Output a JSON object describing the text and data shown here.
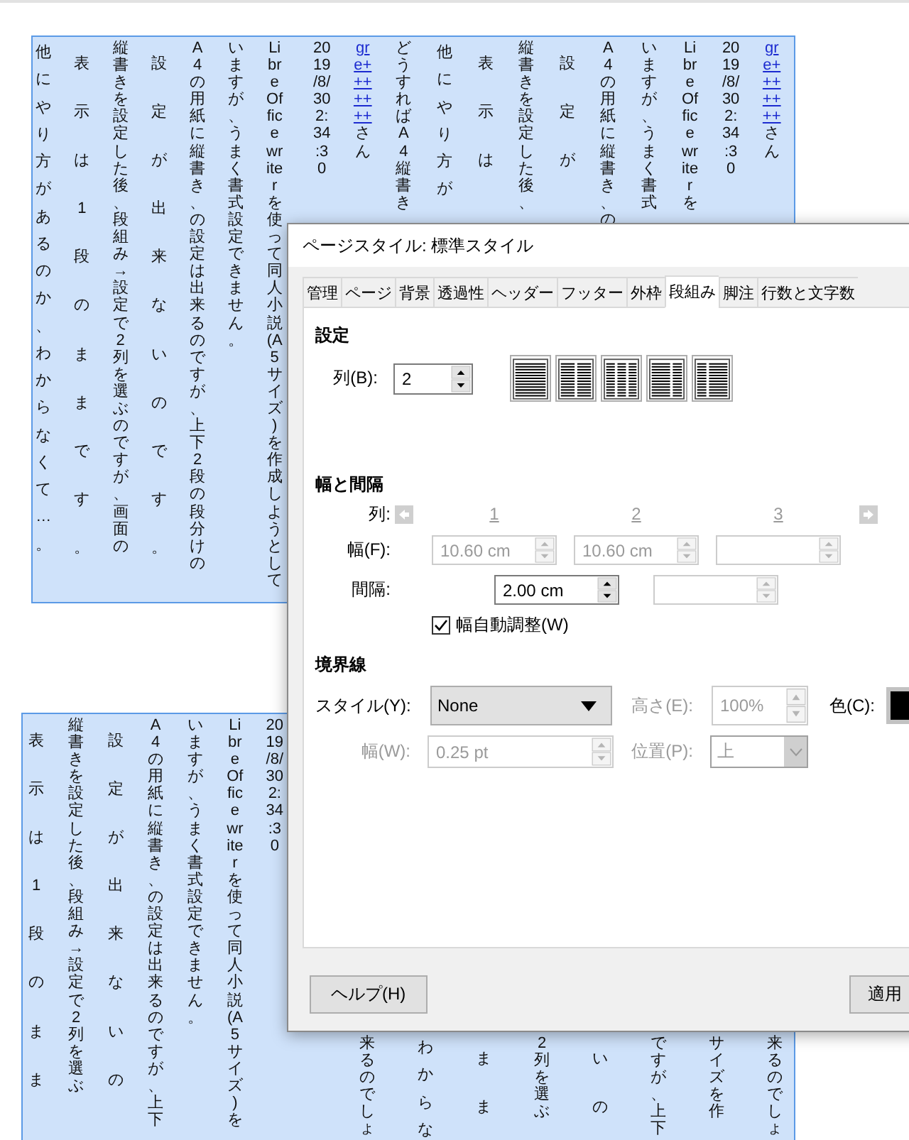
{
  "document": {
    "pages": [
      {
        "left_columns": [
          {
            "kind": "loose",
            "text": "他にやり方があるのか、わからなくて…。"
          },
          {
            "kind": "spaced",
            "text": "表示は1段のままです。"
          },
          {
            "kind": "text",
            "text": "縦書きを設定した後、段組み→設定で2列を選ぶのですが、画面の"
          },
          {
            "kind": "spaced",
            "text": "設定が出来ないのです。"
          },
          {
            "kind": "text",
            "text": "A4の用紙に縦書き、の設定は出来るのですが、上下2段の段分けの"
          },
          {
            "kind": "text",
            "text": "いますが、うまく書式設定できません。"
          },
          {
            "kind": "text",
            "text": "LibreOffice writerを使って同人小説(A5サイズ)を作成しようとして"
          }
        ],
        "right_columns": [
          {
            "kind": "text",
            "text": "2019/8/302:34:30"
          },
          {
            "kind": "user",
            "link": "gre+++++++",
            "suffix": "さん"
          },
          {
            "kind": "text",
            "text": "どうすればA4縦書き"
          },
          {
            "kind": "loose",
            "text": "他にやり方が"
          },
          {
            "kind": "spaced",
            "text": "表示は"
          },
          {
            "kind": "text",
            "text": "縦書きを設定した後、"
          },
          {
            "kind": "spaced",
            "text": "設定が"
          },
          {
            "kind": "text",
            "text": "A4の用紙に縦書き、の"
          },
          {
            "kind": "text",
            "text": "いますが、うまく書式"
          },
          {
            "kind": "text",
            "text": "LibreOffice writerを"
          },
          {
            "kind": "text",
            "text": "2019/8/302:34:30"
          },
          {
            "kind": "user",
            "link": "gre+++++++",
            "suffix": "さん"
          }
        ]
      },
      {
        "left_columns": [
          {
            "kind": "spaced",
            "text": "表示は1段のまま"
          },
          {
            "kind": "text",
            "text": "縦書きを設定した後、段組み→設定で2列を選ぶ"
          },
          {
            "kind": "spaced",
            "text": "設定が出来ないの"
          },
          {
            "kind": "text",
            "text": "A4の用紙に縦書き、の設定は出来るのですが、上下"
          },
          {
            "kind": "text",
            "text": "いますが、うまく書式設定できません。"
          },
          {
            "kind": "text",
            "text": "LibreOffice writerを使って同人小説(A5サイズ)を"
          },
          {
            "kind": "text",
            "text": "2019/8/302:34:30"
          }
        ],
        "right_columns": [
          {
            "kind": "text",
            "text": "来るのでしょ"
          },
          {
            "kind": "loose",
            "text": "わからな"
          },
          {
            "kind": "spaced",
            "text": "まま"
          },
          {
            "kind": "text",
            "text": "2列を選ぶ"
          },
          {
            "kind": "spaced",
            "text": "いの"
          },
          {
            "kind": "text",
            "text": "ですが、上下"
          },
          {
            "kind": "text",
            "text": "サイズを作"
          },
          {
            "kind": "text",
            "text": "来るのでしょ"
          }
        ]
      }
    ]
  },
  "dialog": {
    "title": "ページスタイル: 標準スタイル",
    "tabs": [
      {
        "label": "管理",
        "selected": false
      },
      {
        "label": "ページ",
        "selected": false
      },
      {
        "label": "背景",
        "selected": false
      },
      {
        "label": "透過性",
        "selected": false
      },
      {
        "label": "ヘッダー",
        "selected": false
      },
      {
        "label": "フッター",
        "selected": false
      },
      {
        "label": "外枠",
        "selected": false
      },
      {
        "label": "段組み",
        "selected": true
      },
      {
        "label": "脚注",
        "selected": false
      },
      {
        "label": "行数と文字数",
        "selected": false
      }
    ],
    "settings": {
      "heading": "設定",
      "columns_label": "列(B):",
      "columns_value": "2"
    },
    "width_spacing": {
      "heading": "幅と間隔",
      "column_label": "列:",
      "navigation_disabled": true,
      "column_numbers": [
        "1",
        "2",
        "3"
      ],
      "width_label": "幅(F):",
      "widths": [
        {
          "value": "10.60 cm",
          "disabled": true
        },
        {
          "value": "10.60 cm",
          "disabled": true
        },
        {
          "disabled": true
        }
      ],
      "spacing_label": "間隔:",
      "spacings": [
        {
          "value": "2.00 cm",
          "disabled": false
        },
        {
          "disabled": true
        }
      ],
      "autowidth": {
        "label": "幅自動調整(W)",
        "checked": true
      }
    },
    "separator": {
      "heading": "境界線",
      "style_label": "スタイル(Y):",
      "style_value": "None",
      "height_label": "高さ(E):",
      "height_value": "100%",
      "height_disabled": true,
      "color_label": "色(C):",
      "width_label": "幅(W):",
      "width_value": "0.25 pt",
      "width_disabled": true,
      "position_label": "位置(P):",
      "position_value": "上",
      "position_disabled": true
    },
    "buttons": [
      {
        "label": "ヘルプ(H)"
      },
      {
        "label": "適用"
      }
    ]
  }
}
